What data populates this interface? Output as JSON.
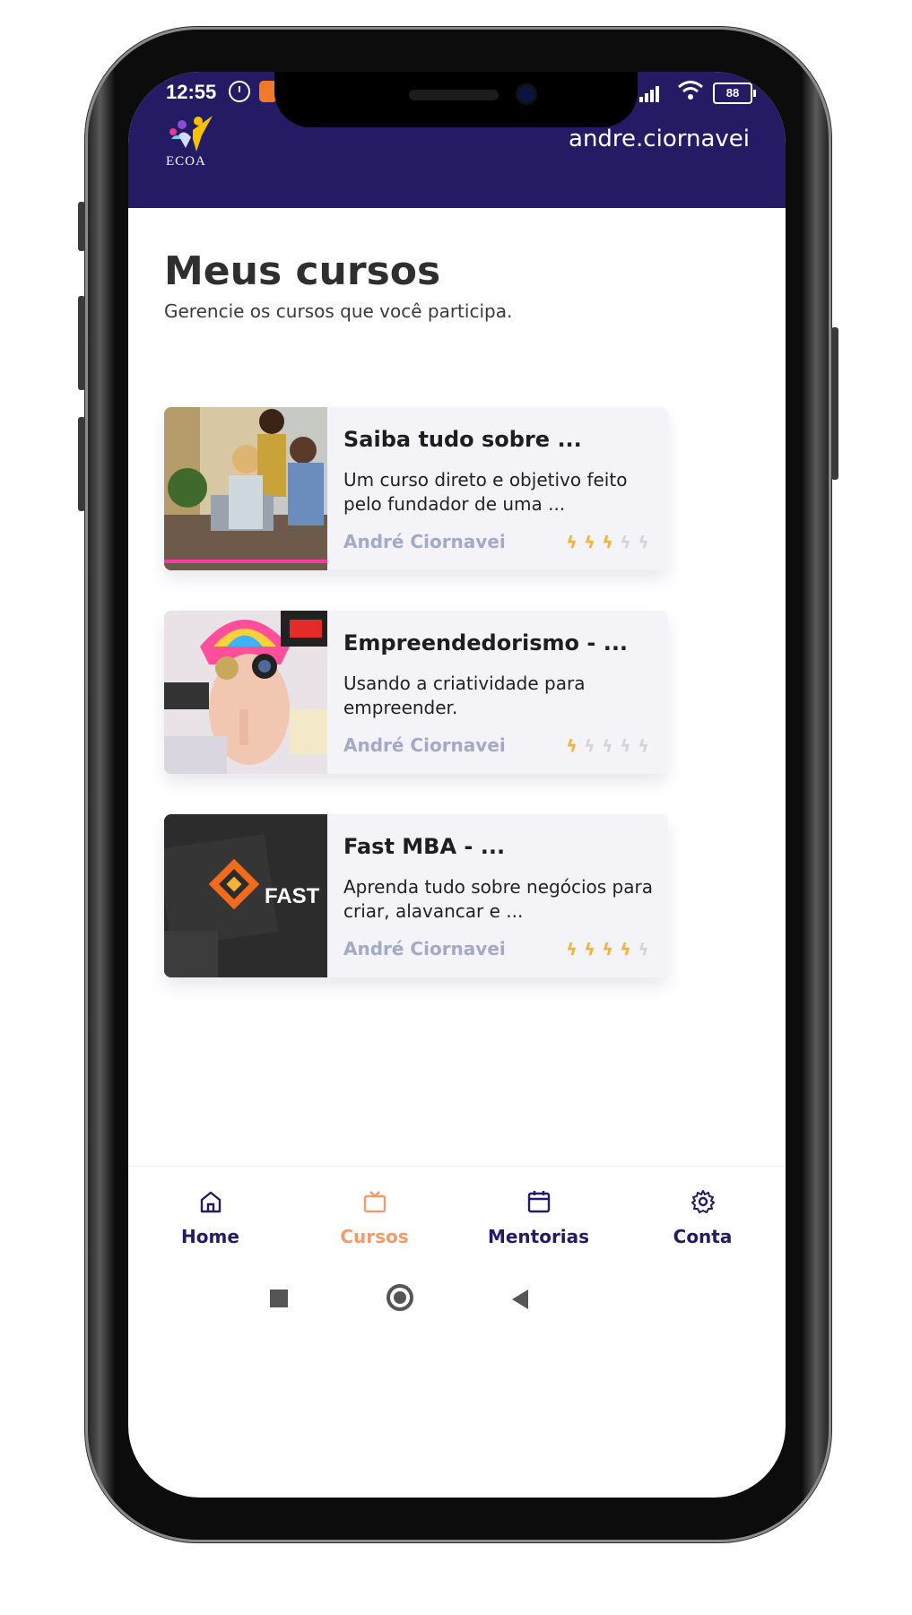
{
  "status_bar": {
    "time": "12:55",
    "battery": "88"
  },
  "header": {
    "logo_text": "ECOA",
    "username": "andre.ciornavei"
  },
  "page": {
    "title": "Meus cursos",
    "subtitle": "Gerencie os cursos que você participa."
  },
  "courses": [
    {
      "title": "Saiba tudo sobre ...",
      "description": "Um curso direto e objetivo feito pelo fundador de uma ...",
      "author": "André Ciornavei",
      "rating": 3,
      "rating_max": 5
    },
    {
      "title": "Empreendedorismo - ...",
      "description": "Usando a criatividade para empreender.",
      "author": "André Ciornavei",
      "rating": 1,
      "rating_max": 5
    },
    {
      "title": "Fast MBA - ...",
      "description": "Aprenda tudo sobre negócios para criar, alavancar e ...",
      "author": "André Ciornavei",
      "rating": 4,
      "rating_max": 5,
      "thumb_text": "FAST"
    }
  ],
  "bottom_nav": [
    {
      "label": "Home",
      "icon": "home-icon",
      "active": false
    },
    {
      "label": "Cursos",
      "icon": "tv-icon",
      "active": true
    },
    {
      "label": "Mentorias",
      "icon": "calendar-icon",
      "active": false
    },
    {
      "label": "Conta",
      "icon": "gear-icon",
      "active": false
    }
  ],
  "colors": {
    "header_bg": "#251b64",
    "nav_active": "#f59a6a",
    "nav_inactive": "#251b64",
    "rating_on": "#f5b237",
    "rating_off": "#d3d3de",
    "author": "#a3aac6"
  }
}
